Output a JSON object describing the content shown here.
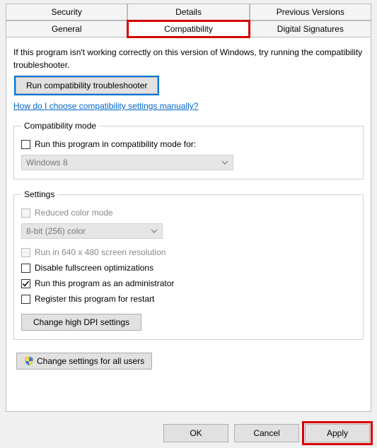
{
  "tabs": {
    "row1": [
      "Security",
      "Details",
      "Previous Versions"
    ],
    "row2": [
      "General",
      "Compatibility",
      "Digital Signatures"
    ],
    "active": "Compatibility"
  },
  "intro": "If this program isn't working correctly on this version of Windows, try running the compatibility troubleshooter.",
  "troubleshooter_btn": "Run compatibility troubleshooter",
  "manual_link": "How do I choose compatibility settings manually?",
  "compat_mode": {
    "legend": "Compatibility mode",
    "checkbox_label": "Run this program in compatibility mode for:",
    "checkbox_checked": false,
    "select_value": "Windows 8"
  },
  "settings": {
    "legend": "Settings",
    "reduced_color": {
      "label": "Reduced color mode",
      "checked": false,
      "disabled": true
    },
    "color_select": "8-bit (256) color",
    "run_640": {
      "label": "Run in 640 x 480 screen resolution",
      "checked": false,
      "disabled": true
    },
    "disable_fullscreen": {
      "label": "Disable fullscreen optimizations",
      "checked": false
    },
    "run_admin": {
      "label": "Run this program as an administrator",
      "checked": true
    },
    "register_restart": {
      "label": "Register this program for restart",
      "checked": false
    },
    "dpi_button": "Change high DPI settings"
  },
  "all_users_btn": "Change settings for all users",
  "buttons": {
    "ok": "OK",
    "cancel": "Cancel",
    "apply": "Apply"
  }
}
